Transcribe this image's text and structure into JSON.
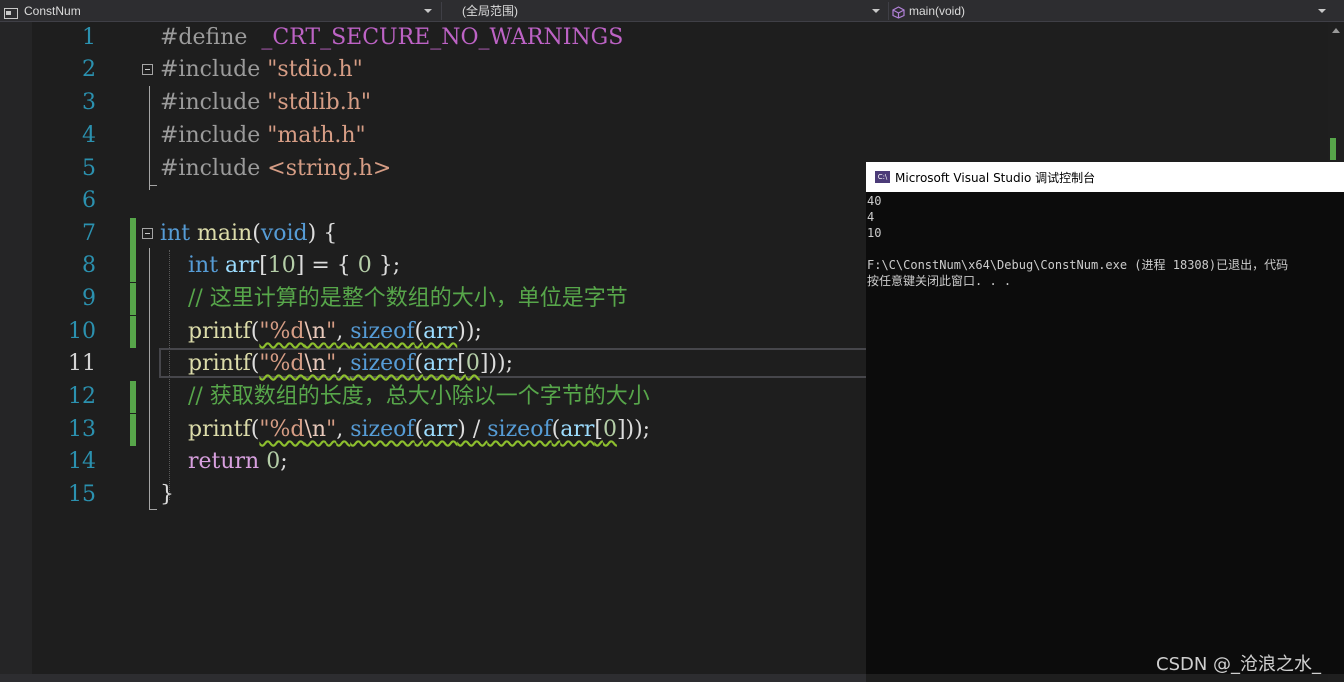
{
  "navbar": {
    "project": "ConstNum",
    "scope": "(全局范围)",
    "member": "main(void)"
  },
  "editor": {
    "lines": [
      {
        "num": "1"
      },
      {
        "num": "2"
      },
      {
        "num": "3"
      },
      {
        "num": "4"
      },
      {
        "num": "5"
      },
      {
        "num": "6"
      },
      {
        "num": "7"
      },
      {
        "num": "8"
      },
      {
        "num": "9"
      },
      {
        "num": "10"
      },
      {
        "num": "11"
      },
      {
        "num": "12"
      },
      {
        "num": "13"
      },
      {
        "num": "14"
      },
      {
        "num": "15"
      }
    ],
    "current_line": "11",
    "tokens": {
      "l1_define": "#define",
      "l1_macro": "_CRT_SECURE_NO_WARNINGS",
      "l2_include": "#include",
      "l2_file": "\"stdio.h\"",
      "l3_include": "#include",
      "l3_file": "\"stdlib.h\"",
      "l4_include": "#include",
      "l4_file": "\"math.h\"",
      "l5_include": "#include",
      "l5_file": "<string.h>",
      "l7_int": "int",
      "l7_main": "main",
      "l7_paren_open": "(",
      "l7_void": "void",
      "l7_rest": ") {",
      "l8_int": "int",
      "l8_arr": "arr",
      "l8_bracket_open": "[",
      "l8_ten": "10",
      "l8_mid": "] = { ",
      "l8_zero": "0",
      "l8_end": " };",
      "l9_comment": "// 这里计算的是整个数组的大小，单位是字节",
      "l10_printf": "printf",
      "l10_open": "(",
      "l10_str": "\"%d",
      "l10_esc": "\\n",
      "l10_strend": "\"",
      "l10_comma": ", ",
      "l10_sizeof": "sizeof",
      "l10_p": "(",
      "l10_arr": "arr",
      "l10_end": "));",
      "l11_printf": "printf",
      "l11_open": "(",
      "l11_str": "\"%d",
      "l11_esc": "\\n",
      "l11_strend": "\"",
      "l11_comma": ", ",
      "l11_sizeof": "sizeof",
      "l11_p": "(",
      "l11_arr": "arr",
      "l11_b": "[",
      "l11_zero": "0",
      "l11_end": "]));",
      "l12_comment": "// 获取数组的长度，总大小除以一个字节的大小",
      "l13_printf": "printf",
      "l13_open": "(",
      "l13_str": "\"%d",
      "l13_esc": "\\n",
      "l13_strend": "\"",
      "l13_comma": ", ",
      "l13_sizeof": "sizeof",
      "l13_p": "(",
      "l13_arr": "arr",
      "l13_div": ") / ",
      "l13_sizeof2": "sizeof",
      "l13_p2": "(",
      "l13_arr2": "arr",
      "l13_b": "[",
      "l13_zero": "0",
      "l13_end": "]));",
      "l14_return": "return",
      "l14_sp": " ",
      "l14_zero": "0",
      "l14_semi": ";",
      "l15_brace": "}"
    }
  },
  "console": {
    "title": "Microsoft Visual Studio 调试控制台",
    "icon_label": "C:\\",
    "output": [
      "40",
      "4",
      "10",
      "",
      "F:\\C\\ConstNum\\x64\\Debug\\ConstNum.exe (进程 18308)已退出，代码",
      "按任意键关闭此窗口. . ."
    ]
  },
  "watermark": "CSDN @_沧浪之水_",
  "colors": {
    "editor_bg": "#1e1e1e",
    "keyword": "#569cd6",
    "string": "#d69d85",
    "comment": "#57a64a",
    "function": "#dcdcaa",
    "variable": "#9cdcfe",
    "number": "#b5cea8",
    "control_keyword": "#d8a0df",
    "line_number": "#2b91af",
    "change_bar": "#57a64a"
  },
  "icons": {
    "project": "cpp-project-icon",
    "member": "method-cube-icon",
    "console": "console-app-icon"
  }
}
